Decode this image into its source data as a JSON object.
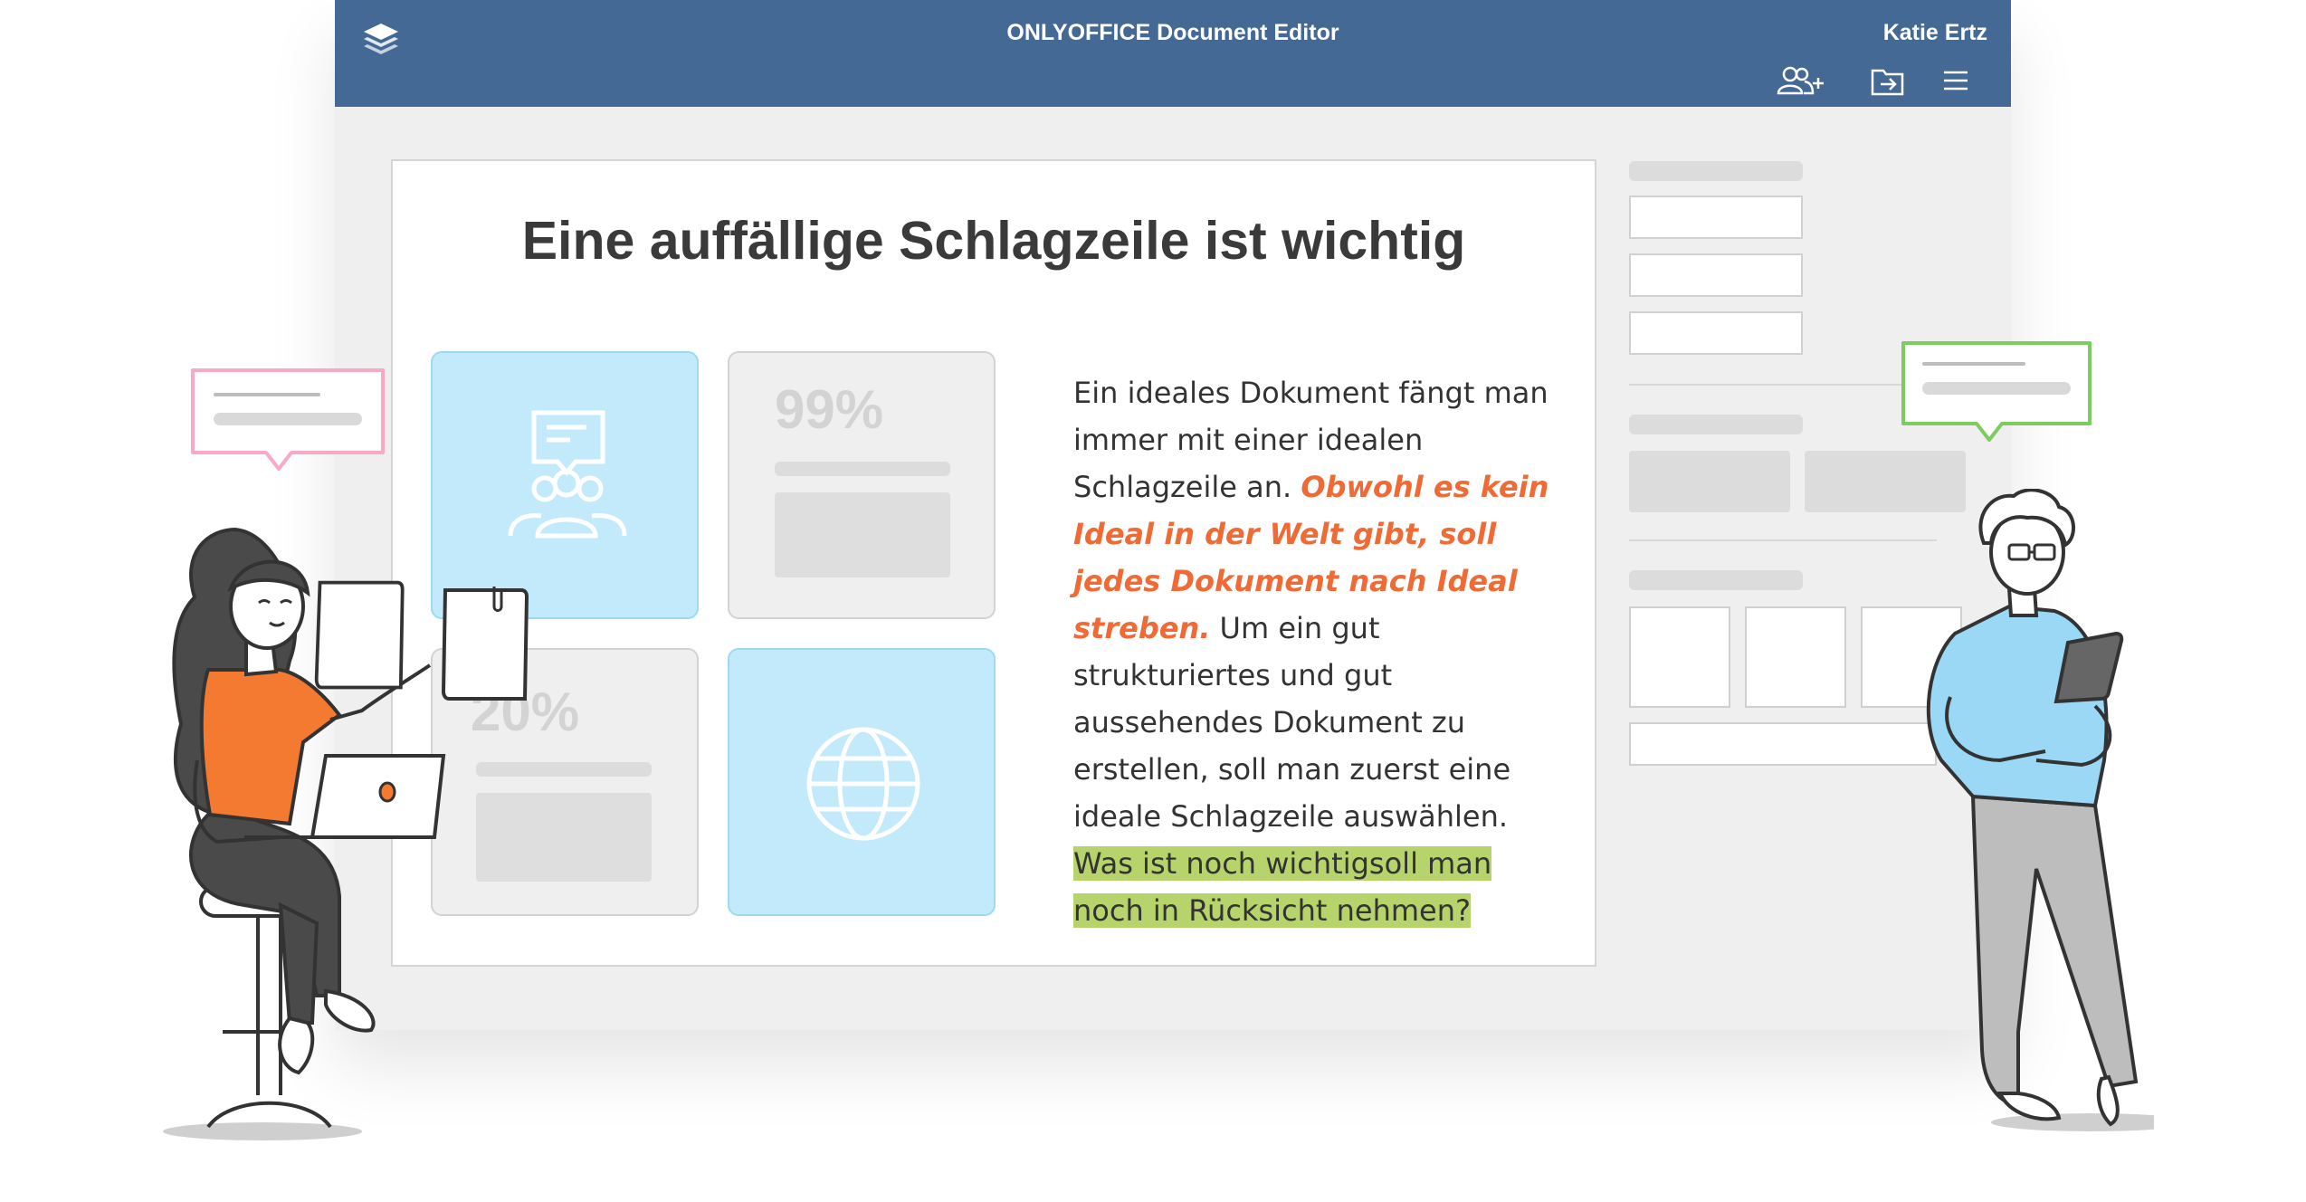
{
  "app": {
    "title": "ONLYOFFICE Document Editor",
    "user": "Katie Ertz"
  },
  "toolbar": {
    "icons": [
      "layers-logo-icon",
      "add-user-icon",
      "open-folder-icon",
      "menu-icon"
    ]
  },
  "document": {
    "headline": "Eine auffällige Schlagzeile ist wichtig",
    "tiles": [
      {
        "type": "icon",
        "icon": "chat-group-icon"
      },
      {
        "type": "stat",
        "value": "99%"
      },
      {
        "type": "stat",
        "value": "20%"
      },
      {
        "type": "icon",
        "icon": "globe-icon"
      }
    ],
    "body": {
      "normal_1": "Ein ideales Dokument fängt man immer mit einer idealen Schlagzeile an.",
      "emphasis": "Obwohl es kein Ideal in der Welt gibt, soll jedes Dokument nach Ideal streben.",
      "normal_2": "Um ein gut strukturiertes und gut aussehendes Dokument zu erstellen, soll man zuerst eine ideale Schlagzeile auswählen.",
      "highlight": "Was ist noch wichtigsoll man noch in Rücksicht nehmen?"
    }
  },
  "colors": {
    "header": "#446995",
    "emphasis": "#ef6a34",
    "highlight": "#b7d36b",
    "tile_blue": "#c2eafb",
    "comment_pink": "#f7a9c5",
    "comment_green": "#7dcc5f"
  }
}
